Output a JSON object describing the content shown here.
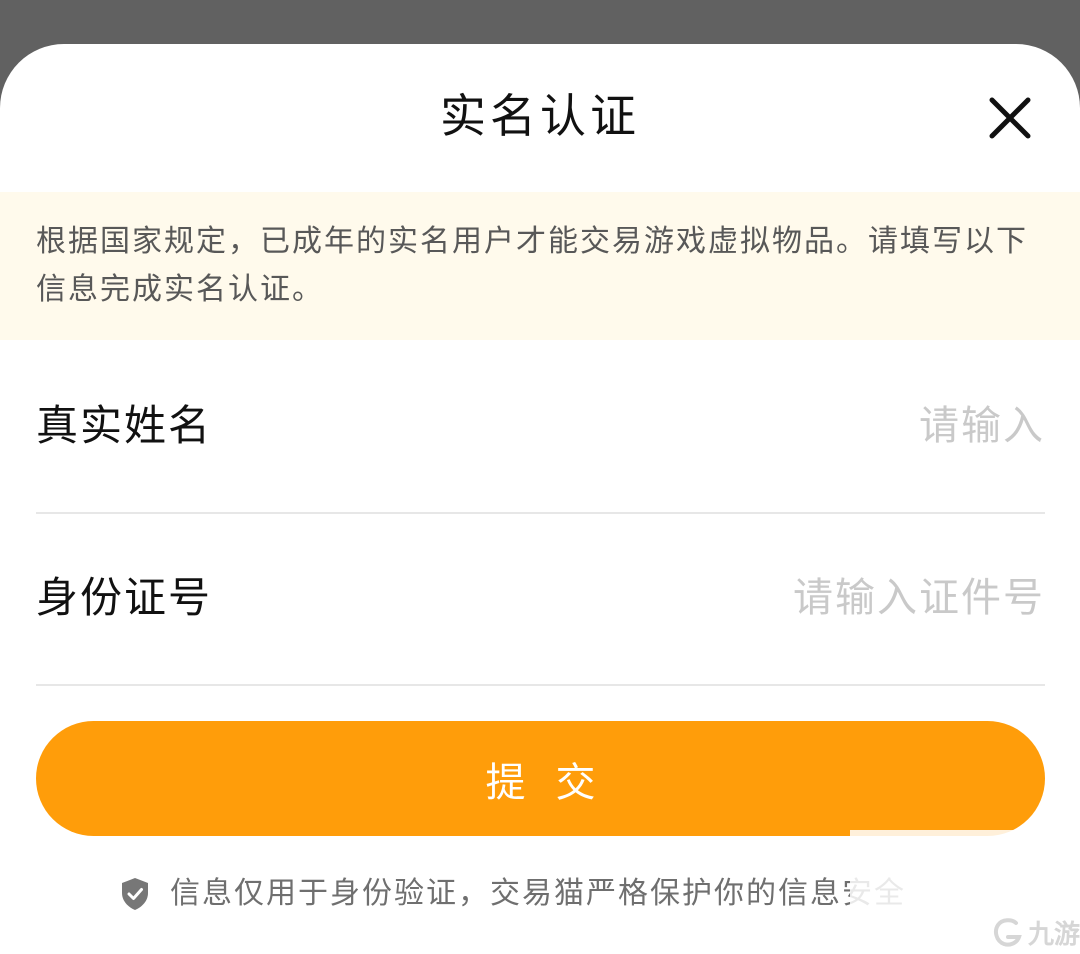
{
  "dialog": {
    "title": "实名认证",
    "close_icon": "close-icon"
  },
  "notice": {
    "text": "根据国家规定，已成年的实名用户才能交易游戏虚拟物品。请填写以下信息完成实名认证。"
  },
  "form": {
    "name_label": "真实姓名",
    "name_placeholder": "请输入",
    "id_label": "身份证号",
    "id_placeholder": "请输入证件号",
    "submit_label": "提交"
  },
  "privacy": {
    "icon": "shield-icon",
    "text": "信息仅用于身份验证，交易猫严格保护你的信息安全"
  },
  "watermark": {
    "text": "九游"
  },
  "colors": {
    "accent": "#ff9d0a",
    "notice_bg": "#fffaec",
    "backdrop": "#616161"
  }
}
